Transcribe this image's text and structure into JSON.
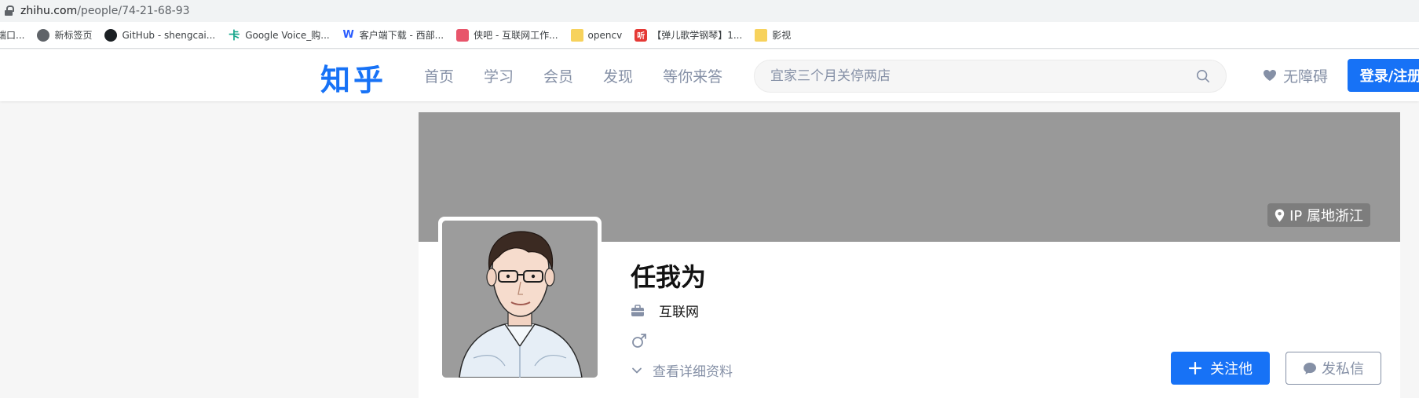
{
  "browser": {
    "url_host": "zhihu.com",
    "url_path": "/people/74-21-68-93",
    "bookmarks": [
      {
        "icon": "partial-icon",
        "label": "端口..."
      },
      {
        "icon": "globe-icon",
        "label": "新标签页"
      },
      {
        "icon": "github-icon",
        "label": "GitHub - shengcai..."
      },
      {
        "icon": "google-voice-icon",
        "label": "Google Voice_购..."
      },
      {
        "icon": "w-icon",
        "label": "客户端下载 - 西部..."
      },
      {
        "icon": "robot-icon",
        "label": "侠吧 - 互联网工作..."
      },
      {
        "icon": "folder-icon",
        "label": "opencv"
      },
      {
        "icon": "ting-icon",
        "label": "【弹儿歌学钢琴】1..."
      },
      {
        "icon": "folder-icon",
        "label": "影视"
      }
    ]
  },
  "header": {
    "logo": "知乎",
    "nav": [
      "首页",
      "学习",
      "会员",
      "发现",
      "等你来答"
    ],
    "search_placeholder": "宜家三个月关停两店",
    "accessibility": "无障碍",
    "login": "登录/注册"
  },
  "profile": {
    "ip_location": "IP 属地浙江",
    "name": "任我为",
    "industry": "互联网",
    "gender_icon": "male-icon",
    "view_details": "查看详细资料",
    "follow": "关注他",
    "message": "发私信"
  },
  "colors": {
    "brand": "#1772f6",
    "cover": "#999999",
    "muted": "#8590a6"
  }
}
